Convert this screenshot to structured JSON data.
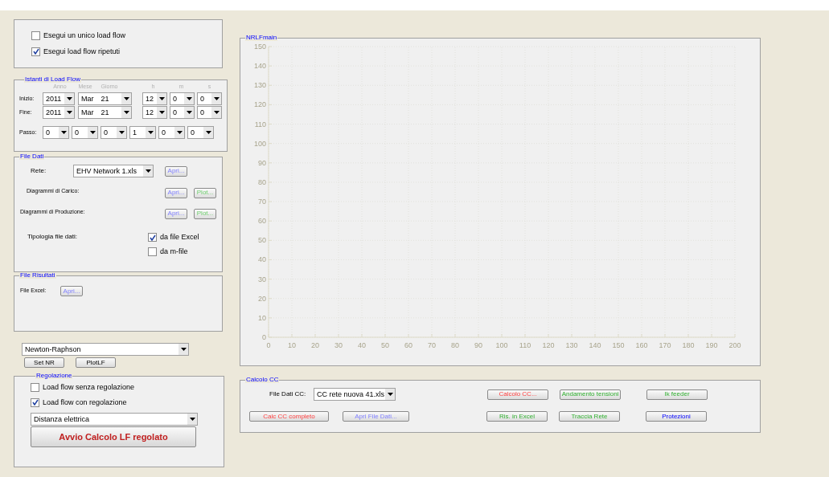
{
  "mode_panel": {
    "checkboxes": [
      {
        "label": "Esegui un unico load flow",
        "checked": false
      },
      {
        "label": "Esegui load flow ripetuti",
        "checked": true
      }
    ]
  },
  "istanti": {
    "title": "Istanti di Load Flow",
    "headers": [
      "Anno",
      "Mese",
      "Giorno",
      "h",
      "m",
      "s"
    ],
    "rows": [
      {
        "label": "Inizio:",
        "fields": [
          "2011",
          "Mar",
          "21",
          "12",
          "0",
          "0"
        ]
      },
      {
        "label": "Fine:",
        "fields": [
          "2011",
          "Mar",
          "21",
          "12",
          "0",
          "0"
        ]
      }
    ],
    "passo": {
      "label": "Passo:",
      "fields": [
        "0",
        "0",
        "0",
        "1",
        "0",
        "0"
      ]
    }
  },
  "file_dati": {
    "title": "File Dati",
    "rete_label": "Rete:",
    "rete_value": "EHV Network 1.xls",
    "rete_button": {
      "label": "Apri...",
      "kind": "file"
    },
    "rows": [
      {
        "label": "Diagrammi di Carico:",
        "buttons": [
          {
            "label": "Apri...",
            "kind": "file"
          },
          {
            "label": "Plot...",
            "kind": "plot"
          }
        ]
      },
      {
        "label": "Diagrammi di Produzione:",
        "buttons": [
          {
            "label": "Apri...",
            "kind": "file"
          },
          {
            "label": "Plot...",
            "kind": "plot"
          }
        ]
      }
    ],
    "tipologia_label": "Tipologia file dati:",
    "checkboxes": [
      {
        "label": "da file Excel",
        "checked": true
      },
      {
        "label": "da m-file",
        "checked": false
      }
    ]
  },
  "file_risultati": {
    "title": "File Risultati",
    "label": "File Excel:",
    "button": {
      "label": "Apri...",
      "kind": "file"
    }
  },
  "method": {
    "value": "Newton-Raphson",
    "buttons": [
      "Set NR",
      "PlotLF"
    ]
  },
  "regolazione": {
    "title": "Regolazione",
    "checkboxes": [
      {
        "label": "Load flow senza regolazione",
        "checked": false
      },
      {
        "label": "Load flow con regolazione",
        "checked": true
      }
    ],
    "dropdown": "Distanza elettrica",
    "run_button": "Avvio Calcolo LF regolato"
  },
  "chart_panel": {
    "title": "NRLFmain",
    "chart_data": {
      "type": "line",
      "grid": true,
      "xlim": [
        0,
        200
      ],
      "ylim": [
        0,
        150
      ],
      "xticks": [
        0,
        10,
        20,
        30,
        40,
        50,
        60,
        70,
        80,
        90,
        100,
        110,
        120,
        130,
        140,
        150,
        160,
        170,
        180,
        190,
        200
      ],
      "yticks": [
        0,
        10,
        20,
        30,
        40,
        50,
        60,
        70,
        80,
        90,
        100,
        110,
        120,
        130,
        140,
        150
      ]
    }
  },
  "calcolo_cc": {
    "title": "Calcolo CC",
    "file_label": "File Dati CC:",
    "file_value": "CC rete nuova 41.xls",
    "top_buttons": [
      {
        "label": "Calcolo CC...",
        "kind": "calc"
      },
      {
        "label": "Andamento tensioni",
        "kind": "result"
      },
      {
        "label": "Ik feeder",
        "kind": "result"
      }
    ],
    "bottom_buttons": [
      {
        "label": "Calc CC completo",
        "kind": "calc"
      },
      {
        "label": "Apri File Dati...",
        "kind": "file"
      },
      {
        "label": "Ris. in Excel",
        "kind": "result"
      },
      {
        "label": "Traccia Rete",
        "kind": "result"
      },
      {
        "label": "Protezioni",
        "kind": "protection"
      }
    ]
  }
}
